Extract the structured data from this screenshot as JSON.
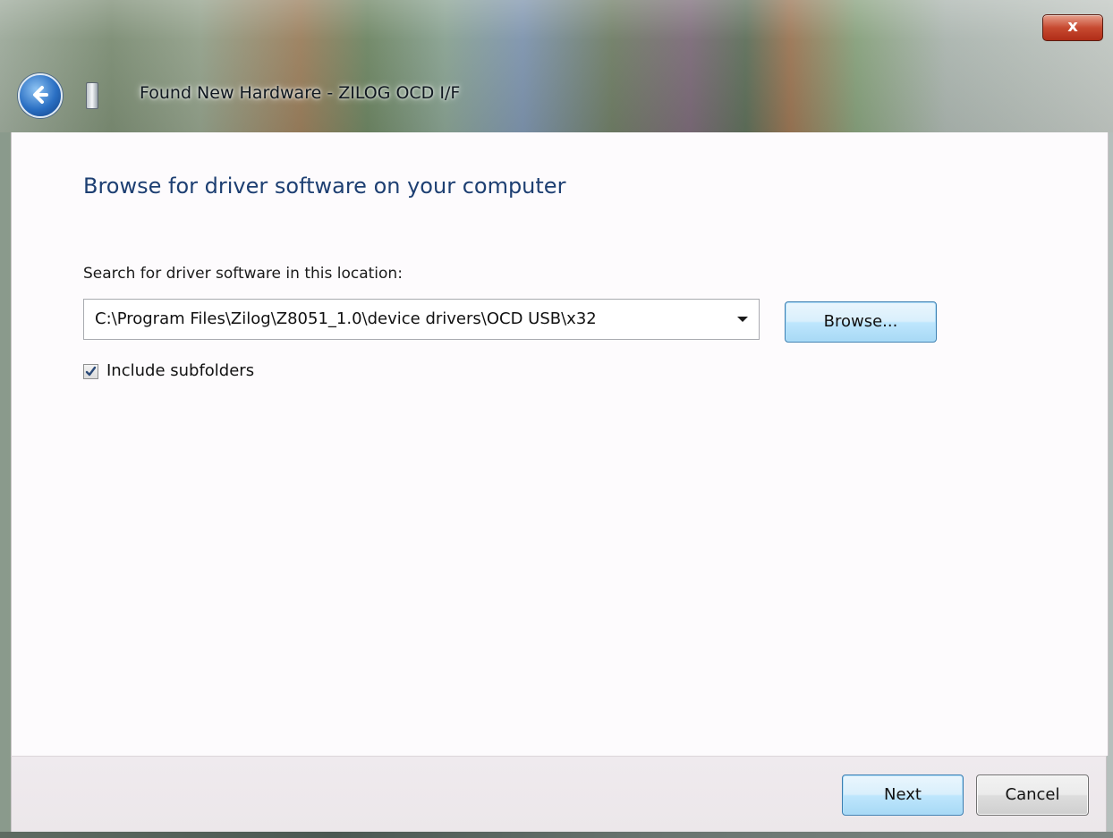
{
  "window": {
    "title": "Found New Hardware - ZILOG OCD I/F",
    "close_label": "x"
  },
  "page": {
    "heading": "Browse for driver software on your computer",
    "search_label": "Search for driver software in this location:",
    "path_value": "C:\\Program Files\\Zilog\\Z8051_1.0\\device drivers\\OCD USB\\x32",
    "browse_label": "Browse...",
    "include_subfolders_label": "Include subfolders",
    "include_subfolders_checked": true
  },
  "footer": {
    "next_label": "Next",
    "cancel_label": "Cancel"
  },
  "icons": {
    "back": "back-arrow-icon",
    "device": "usb-device-icon",
    "dropdown": "chevron-down-icon",
    "check": "checkmark-icon"
  },
  "colors": {
    "heading": "#1d3f72",
    "button_focus_border": "#3c7fb1",
    "close_button": "#c74a31"
  }
}
